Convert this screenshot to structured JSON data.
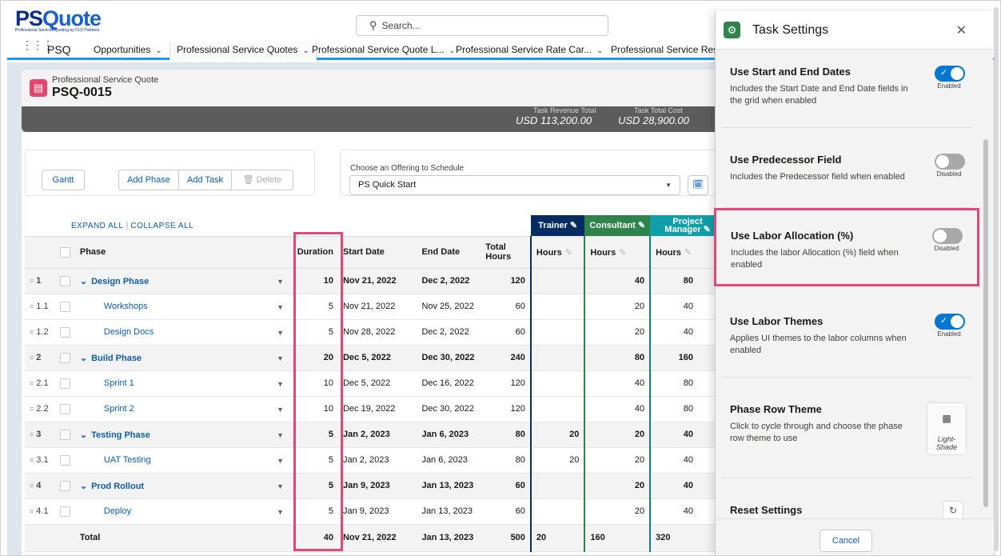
{
  "header": {
    "logo_main_a": "PS",
    "logo_main_b": "Quote",
    "logo_sub": "Professional Services Quoting by CLD Partners",
    "search_placeholder": "Search..."
  },
  "nav": {
    "app_name": "PSQ",
    "items": [
      {
        "label": "Opportunities"
      },
      {
        "label": "Professional Service Quotes"
      },
      {
        "label": "Professional Service Quote L..."
      },
      {
        "label": "Professional Service Rate Car..."
      },
      {
        "label": "Professional Service Resou"
      }
    ]
  },
  "record": {
    "type": "Professional Service Quote",
    "name": "PSQ-0015",
    "revenue_label": "Task Revenue Total",
    "revenue_value": "USD 113,200.00",
    "cost_label": "Task Total Cost",
    "cost_value": "USD 28,900.00"
  },
  "toolbar": {
    "gantt": "Gantt",
    "add_phase": "Add Phase",
    "add_task": "Add Task",
    "delete": "Delete",
    "offering_label": "Choose an Offering to Schedule",
    "offering_value": "PS Quick Start",
    "expand_all": "EXPAND ALL",
    "collapse_all": "COLLAPSE ALL"
  },
  "grid": {
    "headers": {
      "phase": "Phase",
      "duration": "Duration",
      "start": "Start Date",
      "end": "End Date",
      "total_hours": "Total Hours",
      "hours": "Hours"
    },
    "labor": {
      "trainer": "Trainer",
      "consultant": "Consultant",
      "pm": "Project Manager"
    },
    "rows": [
      {
        "num": "1",
        "name": "Design Phase",
        "phase": true,
        "duration": "10",
        "start": "Nov 21, 2022",
        "end": "Dec 2, 2022",
        "total": "120",
        "trainer": "",
        "consultant": "40",
        "pm": "80"
      },
      {
        "num": "1.1",
        "name": "Workshops",
        "phase": false,
        "duration": "5",
        "start": "Nov 21, 2022",
        "end": "Nov 25, 2022",
        "total": "60",
        "trainer": "",
        "consultant": "20",
        "pm": "40"
      },
      {
        "num": "1.2",
        "name": "Design Docs",
        "phase": false,
        "duration": "5",
        "start": "Nov 28, 2022",
        "end": "Dec 2, 2022",
        "total": "60",
        "trainer": "",
        "consultant": "20",
        "pm": "40"
      },
      {
        "num": "2",
        "name": "Build Phase",
        "phase": true,
        "duration": "20",
        "start": "Dec 5, 2022",
        "end": "Dec 30, 2022",
        "total": "240",
        "trainer": "",
        "consultant": "80",
        "pm": "160"
      },
      {
        "num": "2.1",
        "name": "Sprint 1",
        "phase": false,
        "duration": "10",
        "start": "Dec 5, 2022",
        "end": "Dec 16, 2022",
        "total": "120",
        "trainer": "",
        "consultant": "40",
        "pm": "80"
      },
      {
        "num": "2.2",
        "name": "Sprint 2",
        "phase": false,
        "duration": "10",
        "start": "Dec 19, 2022",
        "end": "Dec 30, 2022",
        "total": "120",
        "trainer": "",
        "consultant": "40",
        "pm": "80"
      },
      {
        "num": "3",
        "name": "Testing Phase",
        "phase": true,
        "duration": "5",
        "start": "Jan 2, 2023",
        "end": "Jan 6, 2023",
        "total": "80",
        "trainer": "20",
        "consultant": "20",
        "pm": "40"
      },
      {
        "num": "3.1",
        "name": "UAT Testing",
        "phase": false,
        "duration": "5",
        "start": "Jan 2, 2023",
        "end": "Jan 6, 2023",
        "total": "80",
        "trainer": "20",
        "consultant": "20",
        "pm": "40"
      },
      {
        "num": "4",
        "name": "Prod Rollout",
        "phase": true,
        "duration": "5",
        "start": "Jan 9, 2023",
        "end": "Jan 13, 2023",
        "total": "60",
        "trainer": "",
        "consultant": "20",
        "pm": "40"
      },
      {
        "num": "4.1",
        "name": "Deploy",
        "phase": false,
        "duration": "5",
        "start": "Jan 9, 2023",
        "end": "Jan 13, 2023",
        "total": "60",
        "trainer": "",
        "consultant": "20",
        "pm": "40"
      }
    ],
    "total": {
      "label": "Total",
      "duration": "40",
      "start": "Nov 21, 2022",
      "end": "Jan 13, 2023",
      "total": "500",
      "trainer": "20",
      "consultant": "160",
      "pm": "320"
    }
  },
  "panel": {
    "title": "Task Settings",
    "settings": [
      {
        "title": "Use Start and End Dates",
        "desc": "Includes the Start Date and End Date fields in the grid when enabled",
        "state": "Enabled"
      },
      {
        "title": "Use Predecessor Field",
        "desc": "Includes the Predecessor field when enabled",
        "state": "Disabled"
      },
      {
        "title": "Use Labor Allocation (%)",
        "desc": "Includes the labor Allocation (%) field when enabled",
        "state": "Disabled"
      },
      {
        "title": "Use Labor Themes",
        "desc": "Applies UI themes to the labor columns when enabled",
        "state": "Enabled"
      },
      {
        "title": "Phase Row Theme",
        "desc": "Click to cycle through and choose the phase row theme to use",
        "state": "Light-Shade"
      },
      {
        "title": "Reset Settings",
        "desc": "",
        "state": ""
      }
    ],
    "cancel": "Cancel"
  },
  "colors": {
    "accent": "#0176d3",
    "highlight": "#e4457a",
    "trainer": "#032d60",
    "consultant": "#2e844a",
    "pm": "#0f9fa8"
  },
  "icons": [
    "search-icon",
    "app-launcher-icon",
    "record-icon",
    "trash-icon",
    "gear-icon",
    "close-icon",
    "theme-icon",
    "refresh-icon",
    "pencil-icon",
    "chevron-down-icon",
    "drag-handle-icon"
  ]
}
